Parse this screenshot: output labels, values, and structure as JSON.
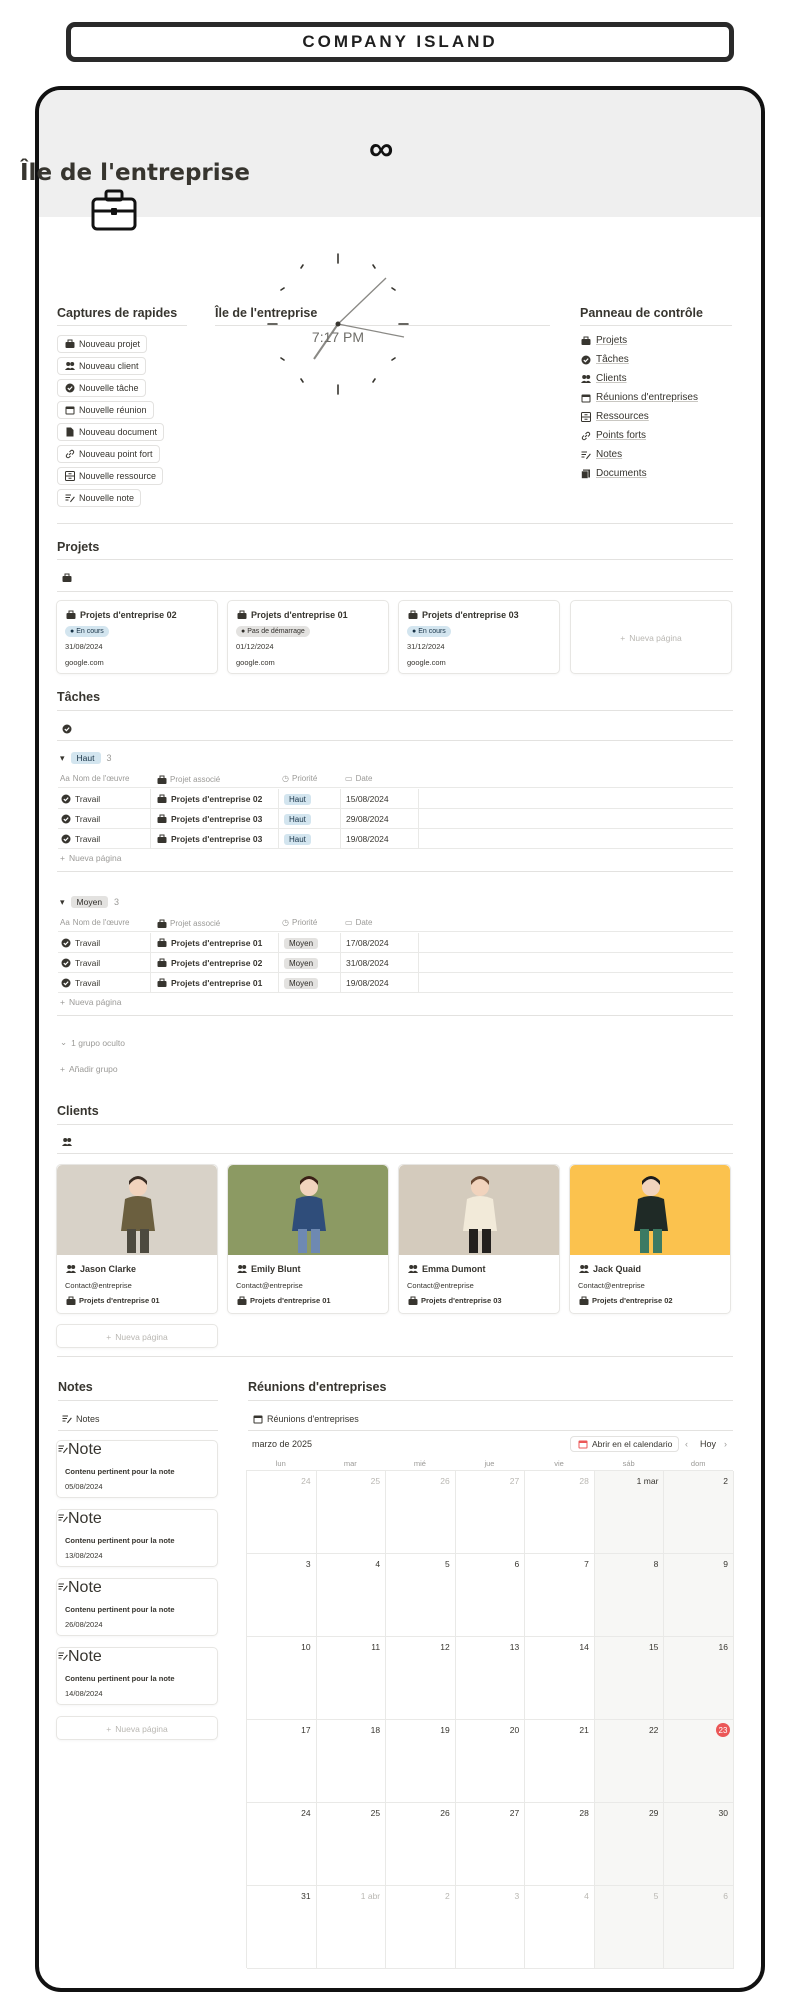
{
  "banner_title": "COMPANY ISLAND",
  "page": {
    "title": "Île de l'entreprise"
  },
  "quick": {
    "heading": "Captures de rapides",
    "items": [
      "Nouveau projet",
      "Nouveau client",
      "Nouvelle tâche",
      "Nouvelle réunion",
      "Nouveau document",
      "Nouveau point fort",
      "Nouvelle ressource",
      "Nouvelle note"
    ]
  },
  "clock": {
    "heading": "Île de l'entreprise",
    "time": "7:17 PM"
  },
  "panel": {
    "heading": "Panneau de contrôle",
    "items": [
      "Projets",
      "Tâches",
      "Clients",
      "Réunions d'entreprises",
      "Ressources",
      "Points forts",
      "Notes",
      "Documents"
    ]
  },
  "projects": {
    "heading": "Projets",
    "cards": [
      {
        "title": "Projets d'entreprise 02",
        "status": "En cours",
        "date": "31/08/2024",
        "url": "google.com"
      },
      {
        "title": "Projets d'entreprise 01",
        "status": "Pas de démarrage",
        "date": "01/12/2024",
        "url": "google.com"
      },
      {
        "title": "Projets d'entreprise 03",
        "status": "En cours",
        "date": "31/12/2024",
        "url": "google.com"
      }
    ],
    "new_page": "Nueva página"
  },
  "tasks": {
    "heading": "Tâches",
    "columns": [
      "Nom de l'œuvre",
      "Projet associé",
      "Priorité",
      "Date"
    ],
    "groups": [
      {
        "name": "Haut",
        "count": "3",
        "rows": [
          {
            "name": "Travail",
            "project": "Projets d'entreprise 02",
            "priority": "Haut",
            "date": "15/08/2024"
          },
          {
            "name": "Travail",
            "project": "Projets d'entreprise 03",
            "priority": "Haut",
            "date": "29/08/2024"
          },
          {
            "name": "Travail",
            "project": "Projets d'entreprise 03",
            "priority": "Haut",
            "date": "19/08/2024"
          }
        ]
      },
      {
        "name": "Moyen",
        "count": "3",
        "rows": [
          {
            "name": "Travail",
            "project": "Projets d'entreprise 01",
            "priority": "Moyen",
            "date": "17/08/2024"
          },
          {
            "name": "Travail",
            "project": "Projets d'entreprise 02",
            "priority": "Moyen",
            "date": "31/08/2024"
          },
          {
            "name": "Travail",
            "project": "Projets d'entreprise 01",
            "priority": "Moyen",
            "date": "19/08/2024"
          }
        ]
      }
    ],
    "new_page": "Nueva página",
    "hidden_group": "1 grupo oculto",
    "add_group": "Añadir grupo"
  },
  "clients": {
    "heading": "Clients",
    "cards": [
      {
        "name": "Jason Clarke",
        "contact": "Contact@entreprise",
        "project": "Projets d'entreprise 01",
        "bg": "#d8d2c8"
      },
      {
        "name": "Emily Blunt",
        "contact": "Contact@entreprise",
        "project": "Projets d'entreprise 01",
        "bg": "#8c9a63"
      },
      {
        "name": "Emma Dumont",
        "contact": "Contact@entreprise",
        "project": "Projets d'entreprise 03",
        "bg": "#d4cbbd"
      },
      {
        "name": "Jack Quaid",
        "contact": "Contact@entreprise",
        "project": "Projets d'entreprise 02",
        "bg": "#fbc24e"
      }
    ],
    "new_page": "Nueva página"
  },
  "notes": {
    "heading": "Notes",
    "view": "Notes",
    "cards": [
      {
        "title": "Note",
        "content": "Contenu pertinent pour la note",
        "date": "05/08/2024"
      },
      {
        "title": "Note",
        "content": "Contenu pertinent pour la note",
        "date": "13/08/2024"
      },
      {
        "title": "Note",
        "content": "Contenu pertinent pour la note",
        "date": "26/08/2024"
      },
      {
        "title": "Note",
        "content": "Contenu pertinent pour la note",
        "date": "14/08/2024"
      }
    ],
    "new_page": "Nueva página"
  },
  "meetings": {
    "heading": "Réunions d'entreprises",
    "view": "Réunions d'entreprises",
    "month": "marzo de 2025",
    "open_calendar": "Abrir en el calendario",
    "today": "Hoy",
    "weekdays": [
      "lun",
      "mar",
      "mié",
      "jue",
      "vie",
      "sáb",
      "dom"
    ],
    "days": [
      "24",
      "25",
      "26",
      "27",
      "28",
      "1 mar",
      "2",
      "3",
      "4",
      "5",
      "6",
      "7",
      "8",
      "9",
      "10",
      "11",
      "12",
      "13",
      "14",
      "15",
      "16",
      "17",
      "18",
      "19",
      "20",
      "21",
      "22",
      "23",
      "24",
      "25",
      "26",
      "27",
      "28",
      "29",
      "30",
      "31",
      "1 abr",
      "2",
      "3",
      "4",
      "5",
      "6"
    ],
    "today_day": "23",
    "accent": "#eb5757"
  }
}
